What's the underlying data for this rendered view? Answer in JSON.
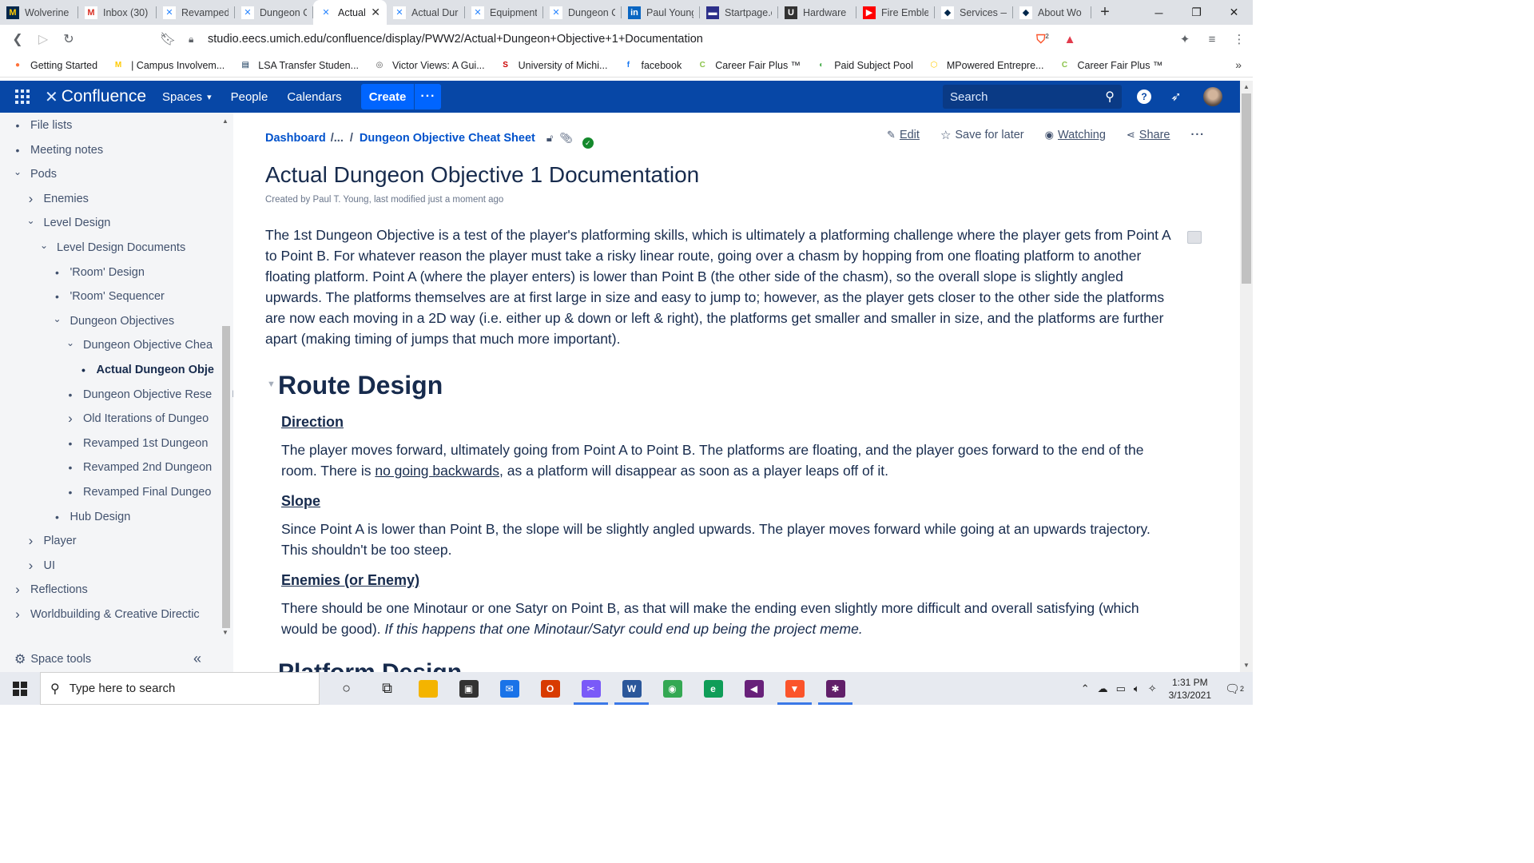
{
  "browser": {
    "tabs": [
      {
        "title": "Wolverine",
        "icon": "M",
        "color": "#00274c",
        "fg": "#ffcb05"
      },
      {
        "title": "Inbox (30)",
        "icon": "M",
        "color": "#ffffff",
        "fg": "#d93025"
      },
      {
        "title": "Revamped",
        "icon": "✕",
        "color": "#ffffff",
        "fg": "#2684ff"
      },
      {
        "title": "Dungeon O",
        "icon": "✕",
        "color": "#ffffff",
        "fg": "#2684ff"
      },
      {
        "title": "Actual",
        "icon": "✕",
        "color": "#ffffff",
        "fg": "#2684ff",
        "active": true
      },
      {
        "title": "Actual Dur",
        "icon": "✕",
        "color": "#ffffff",
        "fg": "#2684ff"
      },
      {
        "title": "Equipment",
        "icon": "✕",
        "color": "#ffffff",
        "fg": "#2684ff"
      },
      {
        "title": "Dungeon O",
        "icon": "✕",
        "color": "#ffffff",
        "fg": "#2684ff"
      },
      {
        "title": "Paul Young",
        "icon": "in",
        "color": "#0a66c2",
        "fg": "#ffffff"
      },
      {
        "title": "Startpage.c",
        "icon": "▬",
        "color": "#2c2f8a",
        "fg": "#ffffff"
      },
      {
        "title": "Hardware",
        "icon": "U",
        "color": "#333333",
        "fg": "#ffffff"
      },
      {
        "title": "Fire Emble",
        "icon": "▶",
        "color": "#ff0000",
        "fg": "#ffffff"
      },
      {
        "title": "Services —",
        "icon": "◆",
        "color": "#ffffff",
        "fg": "#00274c"
      },
      {
        "title": "About Wo",
        "icon": "◆",
        "color": "#ffffff",
        "fg": "#00274c"
      }
    ],
    "url": "studio.eecs.umich.edu/confluence/display/PWW2/Actual+Dungeon+Objective+1+Documentation",
    "brave_badge": "2",
    "bookmarks": [
      {
        "label": "Getting Started",
        "icon": "●",
        "color": "#ff7139"
      },
      {
        "label": "| Campus Involvem...",
        "icon": "M",
        "color": "#ffcb05"
      },
      {
        "label": "LSA Transfer Studen...",
        "icon": "▤",
        "color": "#00274c"
      },
      {
        "label": "Victor Views: A Gui...",
        "icon": "◎",
        "color": "#555555"
      },
      {
        "label": "University of Michi...",
        "icon": "S",
        "color": "#cc0000"
      },
      {
        "label": "facebook",
        "icon": "f",
        "color": "#1877f2"
      },
      {
        "label": "Career Fair Plus ™",
        "icon": "C",
        "color": "#8bc34a"
      },
      {
        "label": "Paid Subject Pool",
        "icon": "◐",
        "color": "#4caf50"
      },
      {
        "label": "MPowered Entrepre...",
        "icon": "⬡",
        "color": "#ffcb05"
      },
      {
        "label": "Career Fair Plus ™",
        "icon": "C",
        "color": "#8bc34a"
      }
    ]
  },
  "header": {
    "logo": "Confluence",
    "spaces": "Spaces",
    "people": "People",
    "calendars": "Calendars",
    "create": "Create",
    "more": "···",
    "search_placeholder": "Search"
  },
  "sidebar": {
    "items": [
      {
        "label": "File lists",
        "indent": 0,
        "marker": "bullet"
      },
      {
        "label": "Meeting notes",
        "indent": 0,
        "marker": "bullet"
      },
      {
        "label": "Pods",
        "indent": 0,
        "marker": "down"
      },
      {
        "label": "Enemies",
        "indent": 1,
        "marker": "right"
      },
      {
        "label": "Level Design",
        "indent": 1,
        "marker": "down"
      },
      {
        "label": "Level Design Documents",
        "indent": 2,
        "marker": "down"
      },
      {
        "label": "'Room' Design",
        "indent": 3,
        "marker": "bullet"
      },
      {
        "label": "'Room' Sequencer",
        "indent": 3,
        "marker": "bullet"
      },
      {
        "label": "Dungeon Objectives",
        "indent": 3,
        "marker": "down"
      },
      {
        "label": "Dungeon Objective Chea",
        "indent": 4,
        "marker": "down"
      },
      {
        "label": "Actual Dungeon Obje",
        "indent": 5,
        "marker": "bullet",
        "current": true
      },
      {
        "label": "Dungeon Objective Rese",
        "indent": 4,
        "marker": "bullet"
      },
      {
        "label": "Old Iterations of Dungeo",
        "indent": 4,
        "marker": "right"
      },
      {
        "label": "Revamped 1st Dungeon",
        "indent": 4,
        "marker": "bullet"
      },
      {
        "label": "Revamped 2nd Dungeon",
        "indent": 4,
        "marker": "bullet"
      },
      {
        "label": "Revamped Final Dungeo",
        "indent": 4,
        "marker": "bullet"
      },
      {
        "label": "Hub Design",
        "indent": 3,
        "marker": "bullet"
      },
      {
        "label": "Player",
        "indent": 1,
        "marker": "right"
      },
      {
        "label": "UI",
        "indent": 1,
        "marker": "right"
      },
      {
        "label": "Reflections",
        "indent": 0,
        "marker": "right"
      },
      {
        "label": "Worldbuilding & Creative Directic",
        "indent": 0,
        "marker": "right"
      }
    ],
    "space_tools": "Space tools"
  },
  "page": {
    "breadcrumb_root": "Dashboard",
    "breadcrumb_ellipsis": "/...",
    "breadcrumb_slash": "/",
    "breadcrumb_parent": "Dungeon Objective Cheat Sheet",
    "actions": {
      "edit": "Edit",
      "save": "Save for later",
      "watching": "Watching",
      "share": "Share"
    },
    "title": "Actual Dungeon Objective 1 Documentation",
    "meta": "Created by Paul T. Young, last modified just a moment ago",
    "intro": "The 1st Dungeon Objective is a test of the player's platforming skills, which is ultimately a platforming challenge where the player gets from Point A to Point B. For whatever reason the player must take a risky linear route, going over a chasm by hopping from one floating platform to another floating platform. Point A (where the player enters) is lower than Point B (the other side of the chasm), so the overall slope is slightly angled upwards. The platforms themselves are at first large in size and easy to jump to; however, as the player gets closer to the other side the platforms are now each moving in a 2D way (i.e. either up & down or left & right), the platforms get smaller and smaller in size, and the platforms are further apart (making timing of jumps that much more important).",
    "route_heading": "Route Design",
    "direction_heading": "Direction",
    "direction_text_1": "The player moves forward, ultimately going from Point A to Point B. The platforms are floating, and the player goes forward to the end of the room. There is ",
    "direction_underline": "no going backwards",
    "direction_text_2": ", as a platform will disappear as soon as a player leaps off of it.",
    "slope_heading": "Slope",
    "slope_text": "Since Point A is lower than Point B, the slope will be slightly angled upwards. The player moves forward while going at an upwards trajectory. This shouldn't be too steep.",
    "enemies_heading": "Enemies (or Enemy)",
    "enemies_text": "There should be one Minotaur or one Satyr on Point B, as that will make the ending even slightly more difficult and overall satisfying (which would be good). ",
    "enemies_italic": "If this happens that one Minotaur/Satyr could end up being the project meme.",
    "next_heading": "Platform Design"
  },
  "taskbar": {
    "search_placeholder": "Type here to search",
    "time": "1:31 PM",
    "date": "3/13/2021",
    "notifications": "2",
    "apps": [
      {
        "name": "cortana-icon",
        "glyph": "○",
        "color": "transparent",
        "fg": "#222"
      },
      {
        "name": "task-view-icon",
        "glyph": "⧉",
        "color": "transparent",
        "fg": "#222"
      },
      {
        "name": "file-explorer-icon",
        "glyph": "▭",
        "color": "#f4b400",
        "fg": "#f4b400"
      },
      {
        "name": "store-icon",
        "glyph": "▣",
        "color": "#333333",
        "fg": "#fff"
      },
      {
        "name": "mail-icon",
        "glyph": "✉",
        "color": "#1a73e8",
        "fg": "#fff"
      },
      {
        "name": "office-icon",
        "glyph": "O",
        "color": "#d83b01",
        "fg": "#fff"
      },
      {
        "name": "snip-icon",
        "glyph": "✂",
        "color": "#7a5af8",
        "fg": "#fff",
        "active": true
      },
      {
        "name": "word-icon",
        "glyph": "W",
        "color": "#2b579a",
        "fg": "#fff",
        "active": true
      },
      {
        "name": "chrome-icon",
        "glyph": "◉",
        "color": "#34a853",
        "fg": "#fff"
      },
      {
        "name": "edge-icon",
        "glyph": "e",
        "color": "#0f9d58",
        "fg": "#fff"
      },
      {
        "name": "visual-studio-icon",
        "glyph": "◀",
        "color": "#68217a",
        "fg": "#fff"
      },
      {
        "name": "brave-icon",
        "glyph": "▼",
        "color": "#fb542b",
        "fg": "#fff",
        "active": true
      },
      {
        "name": "slack-icon",
        "glyph": "✱",
        "color": "#611f69",
        "fg": "#fff",
        "active": true
      }
    ]
  }
}
